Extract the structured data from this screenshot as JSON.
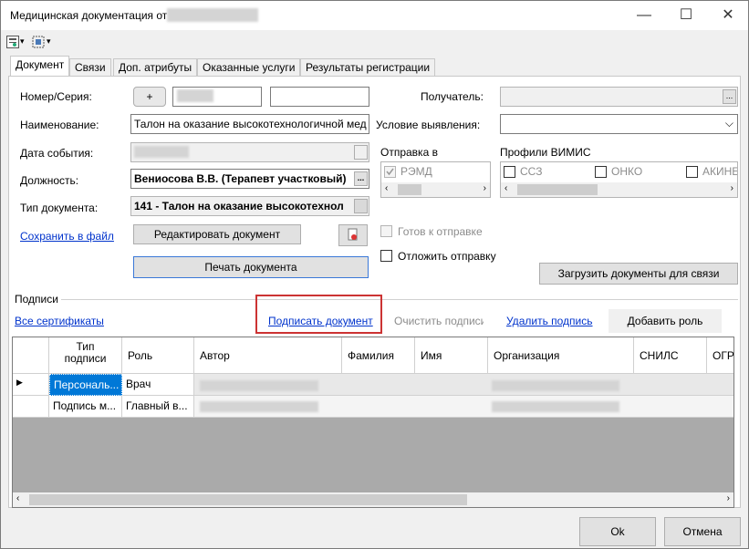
{
  "window": {
    "title": "Медицинская документация от",
    "controls": {
      "minimize": "—",
      "maximize": "☐",
      "close": "✕"
    }
  },
  "toolbar": {
    "icon1": "doc-dropdown-icon",
    "icon2": "layout-dropdown-icon",
    "caret": "▾"
  },
  "tabs": [
    {
      "label": "Документ",
      "active": true
    },
    {
      "label": "Связи"
    },
    {
      "label": "Доп. атрибуты"
    },
    {
      "label": "Оказанные услуги"
    },
    {
      "label": "Результаты регистрации"
    }
  ],
  "form": {
    "number_label": "Номер/Серия:",
    "plus_button": "+",
    "name_label": "Наименование:",
    "name_value": "Талон на оказание высокотехнологичной мед",
    "event_date_label": "Дата события:",
    "position_label": "Должность:",
    "position_value": "Вениосова В.В. (Терапевт участковый)",
    "doc_type_label": "Тип документа:",
    "doc_type_value": "141 - Талон на оказание высокотехнол",
    "save_to_file": "Сохранить в файл",
    "edit_button": "Редактировать документ",
    "print_button": "Печать документа",
    "browse": "..."
  },
  "right": {
    "recipient_label": "Получатель:",
    "condition_label": "Условие выявления:",
    "send_label": "Отправка в",
    "vimis_label": "Профили ВИМИС",
    "remd": "РЭМД",
    "ssz": "ССЗ",
    "onko": "ОНКО",
    "akine": "АКИНЕ",
    "ready_label": "Готов к отправке",
    "postpone_label": "Отложить отправку",
    "load_docs_button": "Загрузить документы для связи",
    "scroll_left": "‹",
    "scroll_right": "›"
  },
  "signatures": {
    "section_label": "Подписи",
    "all_certs": "Все сертификаты",
    "sign_document": "Подписать документ",
    "clear_signature": "Очистить подписи",
    "delete_signature": "Удалить подпись",
    "add_role": "Добавить роль",
    "columns": [
      "Тип подписи",
      "Роль",
      "Автор",
      "Фамилия",
      "Имя",
      "Организация",
      "СНИЛС",
      "ОГР"
    ],
    "rows": [
      {
        "type": "Персональ...",
        "role": "Врач"
      },
      {
        "type": "Подпись м...",
        "role": "Главный в..."
      }
    ],
    "row_pointer": "▶",
    "scroll_left": "‹",
    "scroll_right": "›"
  },
  "footer": {
    "ok": "Ok",
    "cancel": "Отмена"
  }
}
